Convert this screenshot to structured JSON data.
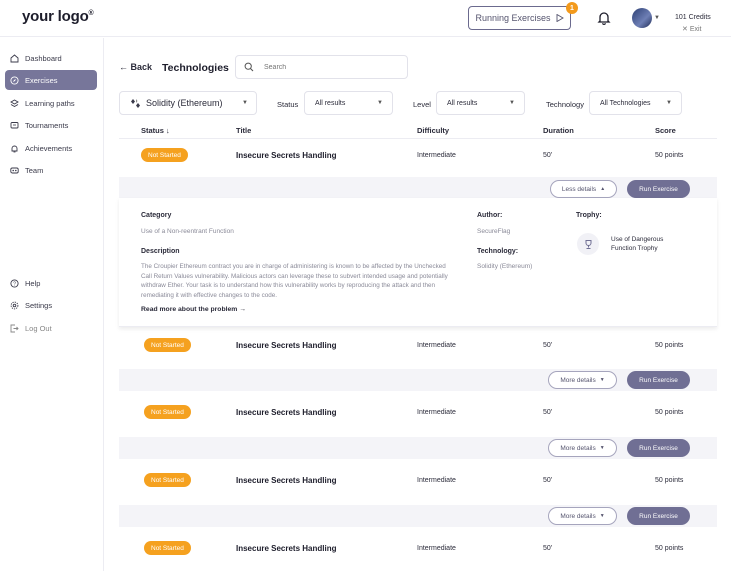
{
  "header": {
    "logo": "your logo",
    "logo_mark": "®",
    "running_label": "Running Exercises",
    "running_count": "1",
    "credits": "101 Credits",
    "exit_label": "Exit"
  },
  "sidebar": {
    "items": [
      {
        "label": "Dashboard",
        "icon": "home-icon"
      },
      {
        "label": "Exercises",
        "icon": "compass-icon",
        "active": true
      },
      {
        "label": "Learning paths",
        "icon": "stack-icon"
      },
      {
        "label": "Tournaments",
        "icon": "trophy-icon"
      },
      {
        "label": "Achievements",
        "icon": "medal-icon"
      },
      {
        "label": "Team",
        "icon": "team-icon"
      }
    ],
    "bottom": [
      {
        "label": "Help",
        "icon": "help-icon"
      },
      {
        "label": "Settings",
        "icon": "gear-icon"
      },
      {
        "label": "Log Out",
        "icon": "logout-icon"
      }
    ]
  },
  "page": {
    "back_label": "Back",
    "title": "Technologies",
    "search_placeholder": "Search"
  },
  "filters": {
    "technology_value": "Solidity (Ethereum)",
    "status_label": "Status",
    "status_value": "All results",
    "level_label": "Level",
    "level_value": "All results",
    "technology_label": "Technology",
    "technology_filter_value": "All Technologies"
  },
  "table": {
    "headers": [
      "Status",
      "Title",
      "Difficulty",
      "Duration",
      "Score"
    ],
    "rows": [
      {
        "status": "Not Started",
        "title": "Insecure Secrets Handling",
        "difficulty": "Intermediate",
        "duration": "50'",
        "score": "50 points",
        "details": "Less details",
        "run": "Run Exercise"
      },
      {
        "status": "Not Started",
        "title": "Insecure Secrets Handling",
        "difficulty": "Intermediate",
        "duration": "50'",
        "score": "50 points",
        "details": "More details",
        "run": "Run Exercise"
      },
      {
        "status": "Not Started",
        "title": "Insecure Secrets Handling",
        "difficulty": "Intermediate",
        "duration": "50'",
        "score": "50 points",
        "details": "More details",
        "run": "Run Exercise"
      },
      {
        "status": "Not Started",
        "title": "Insecure Secrets Handling",
        "difficulty": "Intermediate",
        "duration": "50'",
        "score": "50 points",
        "details": "More details",
        "run": "Run Exercise"
      },
      {
        "status": "Not Started",
        "title": "Insecure Secrets Handling",
        "difficulty": "Intermediate",
        "duration": "50'",
        "score": "50 points"
      }
    ]
  },
  "detail": {
    "category_label": "Category",
    "category_value": "Use of a Non-reentrant Function",
    "description_label": "Description",
    "description": "The Croupier Ethereum contract you are in charge of administering is known to be affected by the Unchecked Call Return Values vulnerability. Malicious actors can leverage these to subvert intended usage and potentially withdraw Ether. Your task is to understand how this vulnerability works by reproducing the attack and then remediating it with effective changes to the code.",
    "read_more": "Read more about the problem",
    "author_label": "Author:",
    "author_value": "SecureFlag",
    "technology_label": "Technology:",
    "technology_value": "Solidity (Ethereum)",
    "trophy_label": "Trophy:",
    "trophy_name": "Use of Dangerous Function Trophy"
  },
  "colors": {
    "accent": "#706f94",
    "badge": "#f5a11f",
    "notification": "#f39a1c"
  }
}
